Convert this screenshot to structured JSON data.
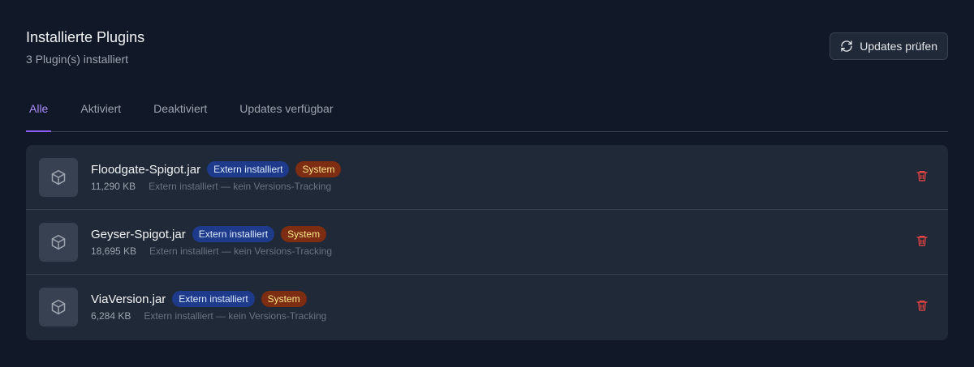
{
  "header": {
    "title": "Installierte Plugins",
    "subtitle": "3 Plugin(s) installiert",
    "updates_button_label": "Updates prüfen"
  },
  "tabs": [
    {
      "label": "Alle",
      "active": true
    },
    {
      "label": "Aktiviert",
      "active": false
    },
    {
      "label": "Deaktiviert",
      "active": false
    },
    {
      "label": "Updates verfügbar",
      "active": false
    }
  ],
  "plugins": [
    {
      "name": "Floodgate-Spigot.jar",
      "badge_extern": "Extern installiert",
      "badge_system": "System",
      "size": "11,290 KB",
      "note": "Extern installiert — kein Versions-Tracking"
    },
    {
      "name": "Geyser-Spigot.jar",
      "badge_extern": "Extern installiert",
      "badge_system": "System",
      "size": "18,695 KB",
      "note": "Extern installiert — kein Versions-Tracking"
    },
    {
      "name": "ViaVersion.jar",
      "badge_extern": "Extern installiert",
      "badge_system": "System",
      "size": "6,284 KB",
      "note": "Extern installiert — kein Versions-Tracking"
    }
  ],
  "icons": {
    "plugin": "package-icon",
    "delete": "trash-icon",
    "refresh": "refresh-icon"
  },
  "colors": {
    "background": "#111827",
    "card": "#1f2937",
    "accent": "#8b5cf6",
    "danger": "#ef4444",
    "badge_extern_bg": "#1e3a8a",
    "badge_system_bg": "#7c2d12"
  }
}
